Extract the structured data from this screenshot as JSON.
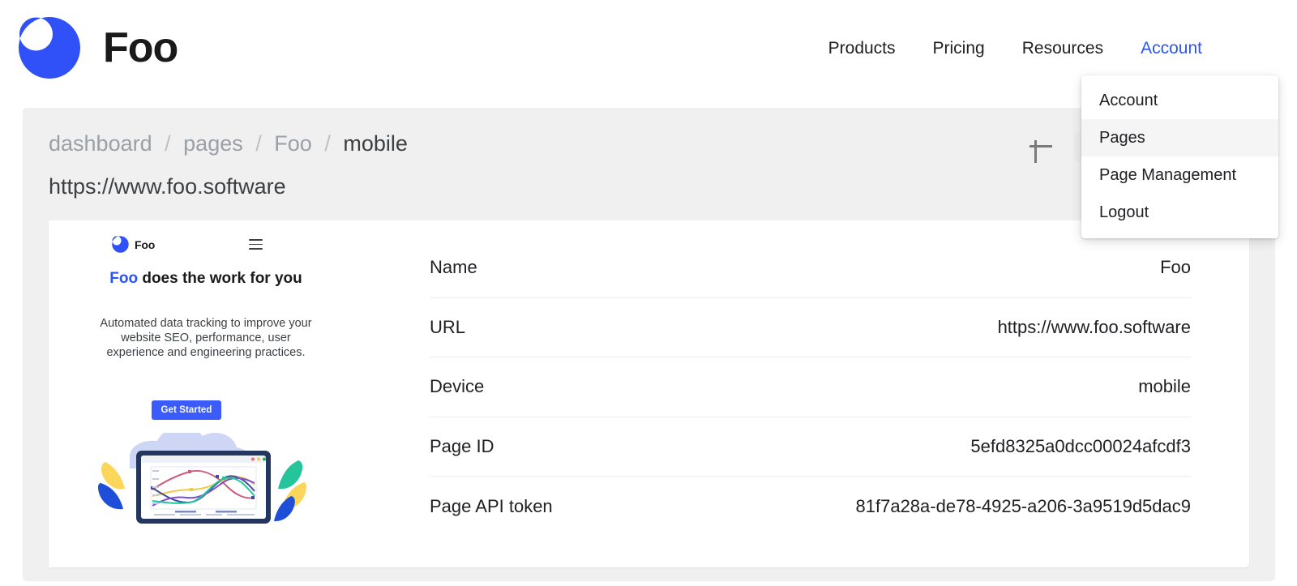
{
  "brand": {
    "name": "Foo",
    "logo_icon": "crescent-moon-icon",
    "color": "#2b54f7"
  },
  "nav": {
    "links": [
      {
        "label": "Products",
        "active": false
      },
      {
        "label": "Pricing",
        "active": false
      },
      {
        "label": "Resources",
        "active": false
      },
      {
        "label": "Account",
        "active": true
      }
    ]
  },
  "account_menu": {
    "items": [
      {
        "label": "Account",
        "highlighted": false
      },
      {
        "label": "Pages",
        "highlighted": true
      },
      {
        "label": "Page Management",
        "highlighted": false
      },
      {
        "label": "Logout",
        "highlighted": false
      }
    ]
  },
  "panel": {
    "breadcrumb": [
      {
        "label": "dashboard",
        "current": false
      },
      {
        "label": "pages",
        "current": false
      },
      {
        "label": "Foo",
        "current": false
      },
      {
        "label": "mobile",
        "current": true
      }
    ],
    "separator": "/",
    "url": "https://www.foo.software",
    "add_icon": "plus-icon"
  },
  "preview": {
    "logo_icon": "crescent-moon-icon",
    "brand_name": "Foo",
    "menu_icon": "hamburger-menu-icon",
    "headline_accent": "Foo",
    "headline_rest": " does the work for you",
    "body": "Automated data tracking to improve your website SEO, performance, user experience and engineering practices.",
    "cta_label": "Get Started",
    "illustration_name": "laptop-line-chart-illustration"
  },
  "details": {
    "rows": [
      {
        "label": "Name",
        "value": "Foo"
      },
      {
        "label": "URL",
        "value": "https://www.foo.software"
      },
      {
        "label": "Device",
        "value": "mobile"
      },
      {
        "label": "Page ID",
        "value": "5efd8325a0dcc00024afcdf3"
      },
      {
        "label": "Page API token",
        "value": "81f7a28a-de78-4925-a206-3a9519d5dac9"
      }
    ]
  }
}
